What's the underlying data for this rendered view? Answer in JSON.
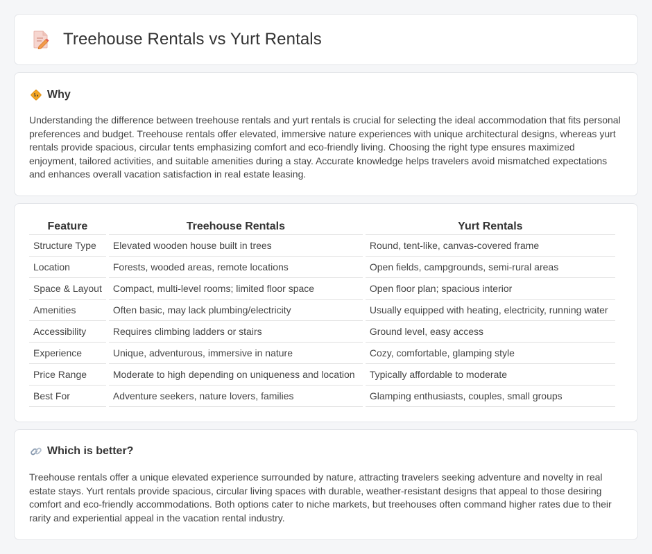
{
  "page": {
    "title": "Treehouse Rentals vs Yurt Rentals",
    "title_icon": "document-pencil-icon"
  },
  "why": {
    "icon": "construction-sign-icon",
    "title": "Why",
    "text": "Understanding the difference between treehouse rentals and yurt rentals is crucial for selecting the ideal accommodation that fits personal preferences and budget. Treehouse rentals offer elevated, immersive nature experiences with unique architectural designs, whereas yurt rentals provide spacious, circular tents emphasizing comfort and eco-friendly living. Choosing the right type ensures maximized enjoyment, tailored activities, and suitable amenities during a stay. Accurate knowledge helps travelers avoid mismatched expectations and enhances overall vacation satisfaction in real estate leasing."
  },
  "table": {
    "headers": [
      "Feature",
      "Treehouse Rentals",
      "Yurt Rentals"
    ],
    "rows": [
      [
        "Structure Type",
        "Elevated wooden house built in trees",
        "Round, tent-like, canvas-covered frame"
      ],
      [
        "Location",
        "Forests, wooded areas, remote locations",
        "Open fields, campgrounds, semi-rural areas"
      ],
      [
        "Space & Layout",
        "Compact, multi-level rooms; limited floor space",
        "Open floor plan; spacious interior"
      ],
      [
        "Amenities",
        "Often basic, may lack plumbing/electricity",
        "Usually equipped with heating, electricity, running water"
      ],
      [
        "Accessibility",
        "Requires climbing ladders or stairs",
        "Ground level, easy access"
      ],
      [
        "Experience",
        "Unique, adventurous, immersive in nature",
        "Cozy, comfortable, glamping style"
      ],
      [
        "Price Range",
        "Moderate to high depending on uniqueness and location",
        "Typically affordable to moderate"
      ],
      [
        "Best For",
        "Adventure seekers, nature lovers, families",
        "Glamping enthusiasts, couples, small groups"
      ]
    ]
  },
  "better": {
    "icon": "link-icon",
    "title": "Which is better?",
    "text": "Treehouse rentals offer a unique elevated experience surrounded by nature, attracting travelers seeking adventure and novelty in real estate stays. Yurt rentals provide spacious, circular living spaces with durable, weather-resistant designs that appeal to those desiring comfort and eco-friendly accommodations. Both options cater to niche markets, but treehouses often command higher rates due to their rarity and experiential appeal in the vacation rental industry."
  }
}
